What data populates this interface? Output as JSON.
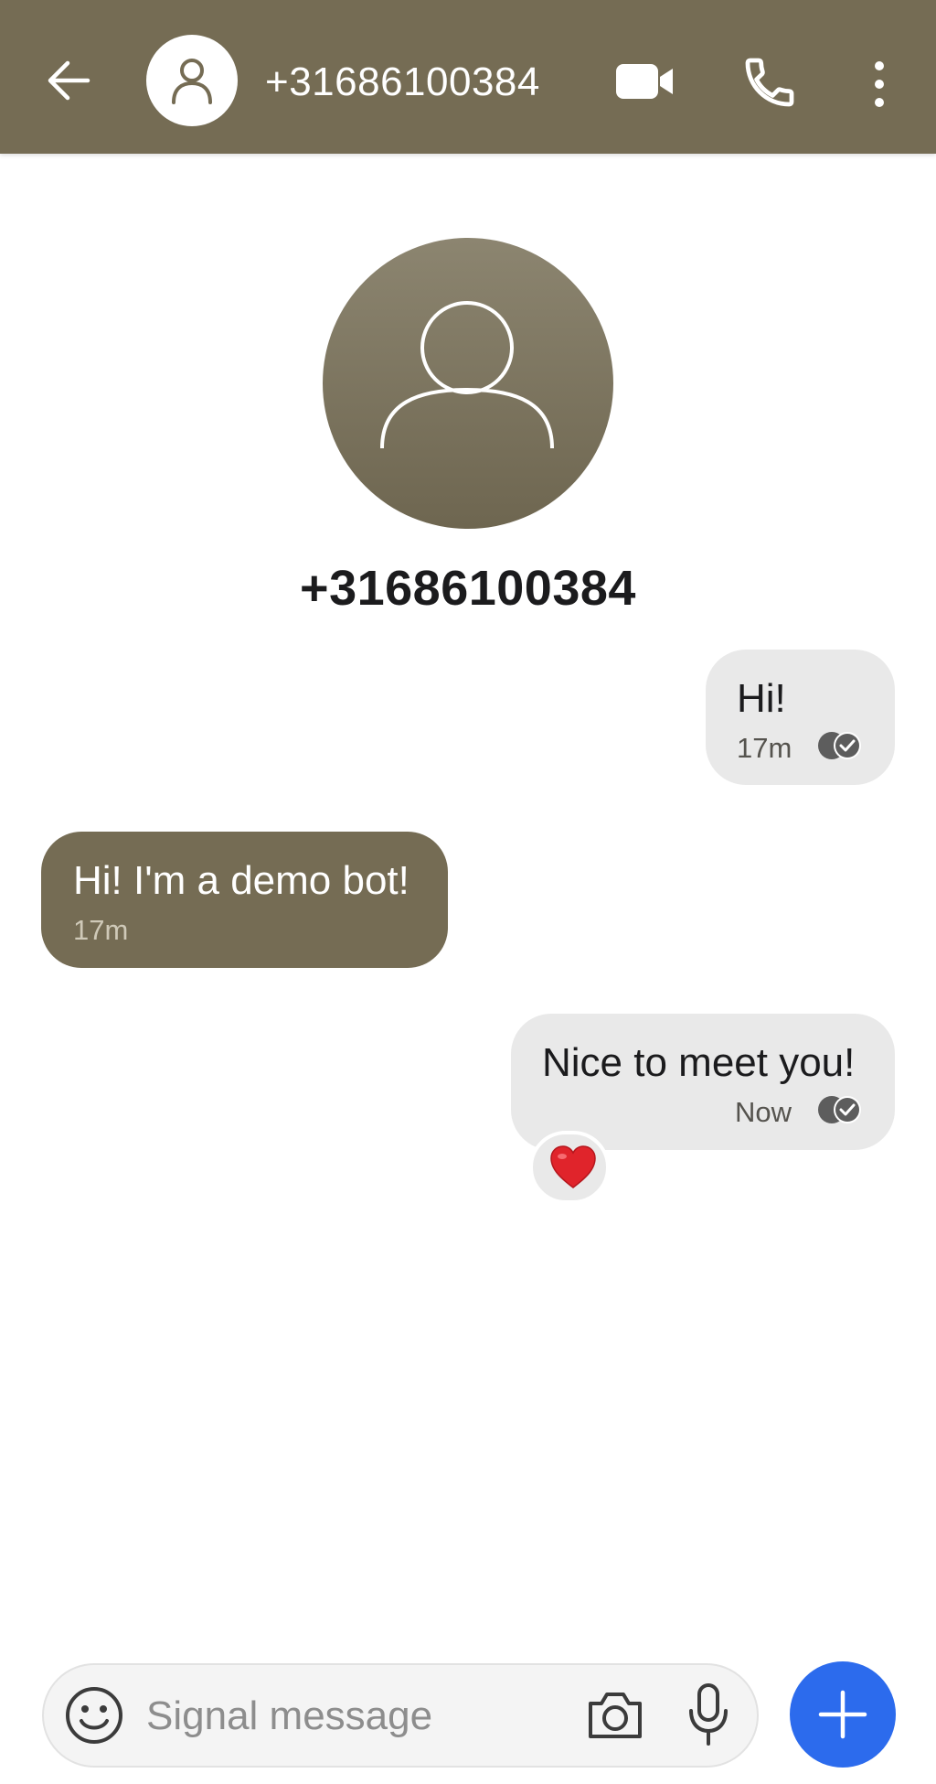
{
  "header": {
    "back_icon": "arrow-left-icon",
    "avatar_icon": "person-icon",
    "contact_name": "+31686100384",
    "video_icon": "video-camera-icon",
    "call_icon": "phone-icon",
    "more_icon": "more-vertical-icon"
  },
  "profile": {
    "avatar_icon": "person-icon",
    "name": "+31686100384"
  },
  "messages": [
    {
      "direction": "outgoing",
      "text": "Hi!",
      "time": "17m",
      "status_icon": "delivered-check-icon"
    },
    {
      "direction": "incoming",
      "text": "Hi! I'm a demo bot!",
      "time": "17m"
    },
    {
      "direction": "outgoing",
      "text": "Nice to meet you!",
      "time": "Now",
      "status_icon": "delivered-check-icon",
      "reaction": "❤️"
    }
  ],
  "composer": {
    "emoji_icon": "smiley-icon",
    "placeholder": "Signal message",
    "camera_icon": "camera-icon",
    "mic_icon": "microphone-icon",
    "attach_icon": "plus-icon"
  },
  "colors": {
    "accent": "#756c54",
    "outgoing_bubble": "#e9e9e9",
    "send_button": "#2c6bed"
  }
}
